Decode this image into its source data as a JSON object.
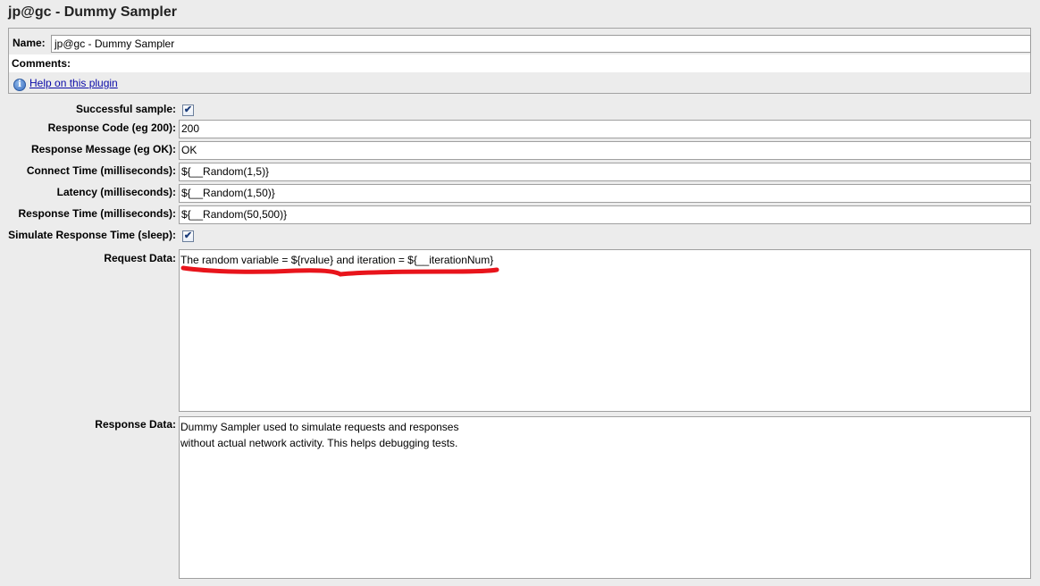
{
  "window": {
    "title": "jp@gc - Dummy Sampler"
  },
  "top": {
    "name_label": "Name:",
    "name_value": "jp@gc - Dummy Sampler",
    "comments_label": "Comments:",
    "help_link": "Help on this plugin"
  },
  "form": {
    "successful_sample": {
      "label": "Successful sample:",
      "checked": true
    },
    "response_code": {
      "label": "Response Code (eg 200):",
      "value": "200"
    },
    "response_message": {
      "label": "Response Message (eg OK):",
      "value": "OK"
    },
    "connect_time": {
      "label": "Connect Time (milliseconds):",
      "value": "${__Random(1,5)}"
    },
    "latency": {
      "label": "Latency (milliseconds):",
      "value": "${__Random(1,50)}"
    },
    "response_time": {
      "label": "Response Time (milliseconds):",
      "value": "${__Random(50,500)}"
    },
    "simulate": {
      "label": "Simulate Response Time (sleep):",
      "checked": true
    },
    "request_data": {
      "label": "Request Data:",
      "value": "The random variable = ${rvalue} and iteration = ${__iterationNum}"
    },
    "response_data": {
      "label": "Response Data:",
      "value": "Dummy Sampler used to simulate requests and responses\nwithout actual network activity. This helps debugging tests."
    }
  },
  "colors": {
    "annotation": "#e8141b",
    "link": "#0a0aa8"
  },
  "icons": {
    "help": "info-icon",
    "check": "checkmark-icon"
  }
}
